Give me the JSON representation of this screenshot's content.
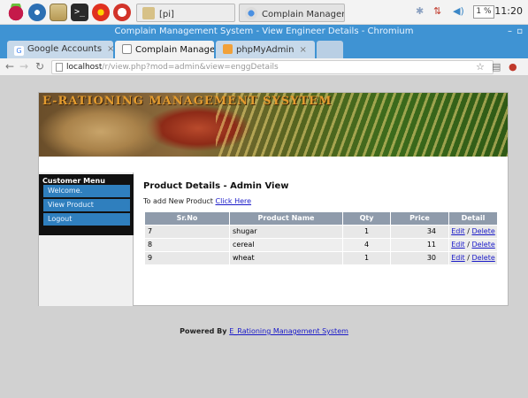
{
  "taskbar": {
    "tasks": [
      {
        "label": "[pi]"
      },
      {
        "label": "Complain Managem..."
      }
    ],
    "cpu": "1 %",
    "clock": "11:20"
  },
  "browser": {
    "window_title": "Complain Management System - View Engineer Details - Chromium",
    "tabs": [
      {
        "label": "Google Accounts"
      },
      {
        "label": "Complain Manage"
      },
      {
        "label": "phpMyAdmin"
      }
    ],
    "url": {
      "host": "localhost",
      "path": "/r/view.php?mod=admin&view=enggDetails"
    }
  },
  "site": {
    "banner_title": "E-RATIONING MANAGEMENT SYSYTEM",
    "menu": {
      "heading": "Customer Menu",
      "items": [
        "Welcome.",
        "View Product",
        "Logout"
      ]
    },
    "content": {
      "title": "Product Details - Admin View",
      "add_text": "To add New Product",
      "add_link": "Click Here",
      "table": {
        "headers": [
          "Sr.No",
          "Product Name",
          "Qty",
          "Price",
          "Detail"
        ],
        "rows": [
          {
            "sr": "7",
            "name": "shugar",
            "qty": "1",
            "price": "34",
            "edit": "Edit",
            "sep": "/",
            "delete": "Delete"
          },
          {
            "sr": "8",
            "name": "cereal",
            "qty": "4",
            "price": "11",
            "edit": "Edit",
            "sep": "/",
            "delete": "Delete"
          },
          {
            "sr": "9",
            "name": "wheat",
            "qty": "1",
            "price": "30",
            "edit": "Edit",
            "sep": "/",
            "delete": "Delete"
          }
        ]
      }
    },
    "footer": {
      "text": "Powered By",
      "link": "E_Rationing Management System"
    }
  }
}
